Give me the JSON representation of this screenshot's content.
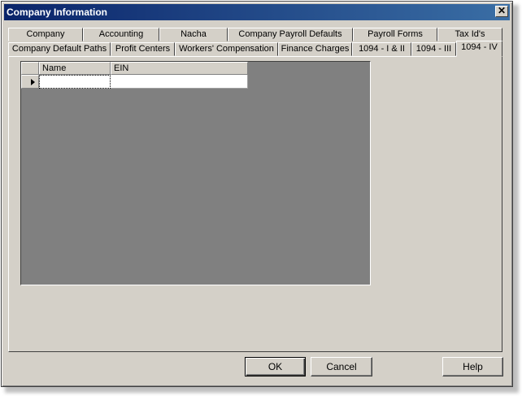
{
  "window": {
    "title": "Company Information",
    "close_symbol": "✕"
  },
  "tabs": {
    "row1": [
      "Company",
      "Accounting",
      "Nacha",
      "Company Payroll Defaults",
      "Payroll Forms",
      "Tax Id's"
    ],
    "row2": [
      "Company Default Paths",
      "Profit Centers",
      "Workers' Compensation",
      "Finance Charges",
      "1094 - I & II",
      "1094 - III",
      "1094 - IV"
    ],
    "active": "1094 - IV"
  },
  "grid": {
    "columns": [
      "Name",
      "EIN"
    ],
    "rows": [
      {
        "name": "",
        "ein": ""
      }
    ]
  },
  "buttons": {
    "ok": "OK",
    "cancel": "Cancel",
    "help": "Help"
  }
}
